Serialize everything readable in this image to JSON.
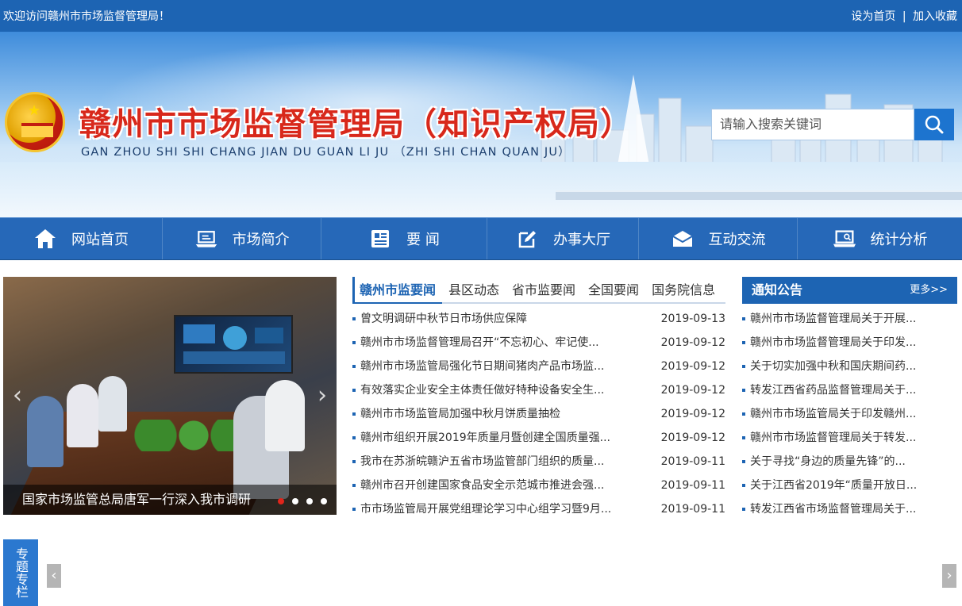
{
  "topbar": {
    "welcome": "欢迎访问赣州市市场监督管理局！",
    "set_home": "设为首页",
    "separator": "|",
    "add_favorite": "加入收藏"
  },
  "header": {
    "title": "赣州市市场监督管理局（知识产权局）",
    "subtitle": "GAN ZHOU SHI SHI CHANG JIAN DU GUAN LI JU （ZHI SHI CHAN QUAN JU）"
  },
  "search": {
    "placeholder": "请输入搜索关键词",
    "icon": "search-icon"
  },
  "nav": {
    "items": [
      {
        "label": "网站首页",
        "icon": "home-icon"
      },
      {
        "label": "市场简介",
        "icon": "laptop-icon"
      },
      {
        "label": "要 闻",
        "icon": "newspaper-icon"
      },
      {
        "label": "办事大厅",
        "icon": "edit-icon"
      },
      {
        "label": "互动交流",
        "icon": "mail-icon"
      },
      {
        "label": "统计分析",
        "icon": "computer-icon"
      }
    ]
  },
  "slider": {
    "caption": "国家市场监管总局唐军一行深入我市调研",
    "slide_count": 4,
    "active_slide": 1
  },
  "news": {
    "tabs": [
      "赣州市监要闻",
      "县区动态",
      "省市监要闻",
      "全国要闻",
      "国务院信息"
    ],
    "active_tab": 0,
    "items": [
      {
        "title": "曾文明调研中秋节日市场供应保障",
        "date": "2019-09-13"
      },
      {
        "title": "赣州市市场监督管理局召开“不忘初心、牢记使...",
        "date": "2019-09-12"
      },
      {
        "title": "赣州市市场监管局强化节日期间猪肉产品市场监...",
        "date": "2019-09-12"
      },
      {
        "title": "有效落实企业安全主体责任做好特种设备安全生...",
        "date": "2019-09-12"
      },
      {
        "title": "赣州市市场监管局加强中秋月饼质量抽检",
        "date": "2019-09-12"
      },
      {
        "title": "赣州市组织开展2019年质量月暨创建全国质量强...",
        "date": "2019-09-12"
      },
      {
        "title": "我市在苏浙皖赣沪五省市场监管部门组织的质量...",
        "date": "2019-09-11"
      },
      {
        "title": "赣州市召开创建国家食品安全示范城市推进会强...",
        "date": "2019-09-11"
      },
      {
        "title": "市市场监管局开展党组理论学习中心组学习暨9月...",
        "date": "2019-09-11"
      }
    ]
  },
  "notices": {
    "title": "通知公告",
    "more": "更多>>",
    "items": [
      "赣州市市场监督管理局关于开展...",
      "赣州市市场监督管理局关于印发...",
      "关于切实加强中秋和国庆期间药...",
      "转发江西省药品监督管理局关于...",
      "赣州市市场监管局关于印发赣州...",
      "赣州市市场监督管理局关于转发...",
      "关于寻找“身边的质量先锋”的...",
      "关于江西省2019年“质量开放日...",
      "转发江西省市场监督管理局关于..."
    ]
  },
  "special": {
    "label": "专题专栏"
  },
  "colors": {
    "primary": "#1d64b3",
    "nav": "#2668b8",
    "title_red": "#d8281b",
    "active_dot": "#e0251b"
  }
}
